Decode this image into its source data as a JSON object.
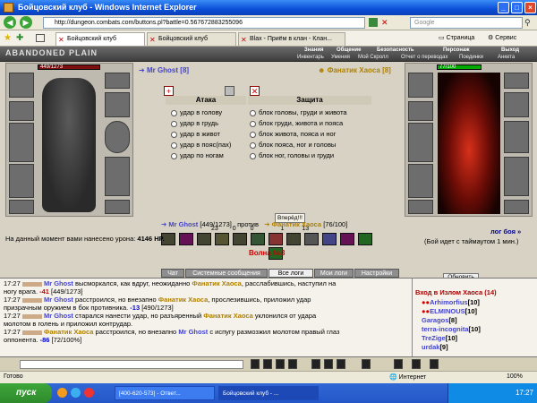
{
  "window": {
    "title": "Бойцовский клуб - Windows Internet Explorer"
  },
  "address": {
    "url": "http://dungeon.combats.com/buttons.pl?battle=0.567672883255096",
    "search_placeholder": "Google"
  },
  "tabs": [
    {
      "label": "Бойцовский клуб"
    },
    {
      "label": "Бойцовский клуб"
    },
    {
      "label": "Blax - Приём в клан - Клан..."
    }
  ],
  "toolbar_right": {
    "page": "Страница",
    "tools": "Сервис"
  },
  "game": {
    "logo": "ABANDONED PLAIN",
    "menu": [
      "Знания",
      "Общение",
      "Безопасность",
      "Персонаж",
      "Выход"
    ],
    "submenu": [
      "Инвентарь",
      "Умения",
      "Мой Скролл",
      "Отчет о переводах",
      "Поединки",
      "Анкета"
    ],
    "player": {
      "name": "Mr Ghost",
      "level": "[8]",
      "hp": "449/1273"
    },
    "enemy": {
      "name": "Фанатик Хаоса",
      "level": "[8]",
      "hp": "77/100"
    },
    "attack_header": "Атака",
    "defense_header": "Защита",
    "attacks": [
      "удар в голову",
      "удар в грудь",
      "удар в живот",
      "удар в пояс(пах)",
      "удар по ногам"
    ],
    "defenses": [
      "блок головы, груди и живота",
      "блок груди, живота и пояса",
      "блок живота, пояса и ног",
      "блок пояса, ног и головы",
      "блок ног, головы и груди"
    ],
    "go_button": "Вперёд!!!",
    "counters": [
      "23",
      "0",
      "0",
      "1",
      "13"
    ],
    "versus": {
      "left_name": "Mr Ghost",
      "left_hp": "[449/1273]",
      "middle": "против",
      "right_name": "Фанатик Хаоса",
      "right_hp": "[76/100]"
    },
    "log_link": "лог боя »",
    "timeout_note": "(Бой идет с таймаутом 1 мин.)",
    "damage_text": "На данный момент вами нанесено урона: ",
    "damage_value": "4146 HP.",
    "wave": "Волна №3"
  },
  "chat_tabs": [
    "Чат",
    "Системные сообщения",
    "Все логи",
    "Мои логи",
    "Настройки"
  ],
  "chat_lines": [
    {
      "time": "17:27",
      "a": "Mr Ghost",
      "t1": " высморкался, как вдруг, неожиданно ",
      "b": "Фанатик Хаоса",
      "t2": ", расслабившись, наступил на"
    },
    {
      "time": "",
      "a": "",
      "t1": "ногу врага. ",
      "b": "",
      "t2": "",
      "dmg": "-41",
      "tail": " [449/1273]"
    },
    {
      "time": "17:27",
      "a": "Mr Ghost",
      "t1": " расстроился, но внезапно ",
      "b": "Фанатик Хаоса",
      "t2": ", прослезившись, приложил удар"
    },
    {
      "time": "",
      "a": "",
      "t1": "призрачным оружием в бок противника. ",
      "b": "",
      "t2": "",
      "dmg": "-13",
      "tail": " [490/1273]"
    },
    {
      "time": "17:27",
      "a": "Mr Ghost",
      "t1": " старался нанести удар, но разъяренный ",
      "b": "Фанатик Хаоса",
      "t2": " уклонился от удара"
    },
    {
      "time": "",
      "a": "",
      "t1": "молотом в голень и приложил контрудар.",
      "b": "",
      "t2": ""
    },
    {
      "time": "17:27",
      "a": "Фанатик Хаоса",
      "t1": " расстроился, но внезапно ",
      "b": "Mr Ghost",
      "t2": " с испугу размозжил молотом правый глаз"
    },
    {
      "time": "",
      "a": "",
      "t1": "оппонента. ",
      "b": "",
      "t2": "",
      "dmgb": "-86",
      "tail": " [72/100%]"
    }
  ],
  "right_panel": {
    "refresh": "Обновить",
    "title": "Вход в Излом Хаоса (14)",
    "users": [
      {
        "name": "Arhimorfius",
        "lvl": "[10]"
      },
      {
        "name": "ELMINOUS",
        "lvl": "[10]"
      },
      {
        "name": "Garagos",
        "lvl": "[8]"
      },
      {
        "name": "terra-incognita",
        "lvl": "[10]"
      },
      {
        "name": "TreZige",
        "lvl": "[10]"
      },
      {
        "name": "urdak",
        "lvl": "[9]"
      }
    ]
  },
  "status": {
    "left": "Готово",
    "zone": "Интернет",
    "zoom": "100%"
  },
  "taskbar": {
    "start": "пуск",
    "items": [
      "[400-620-573] - Ответ...",
      "Бойцовский клуб - ..."
    ],
    "clock": "17:27"
  }
}
